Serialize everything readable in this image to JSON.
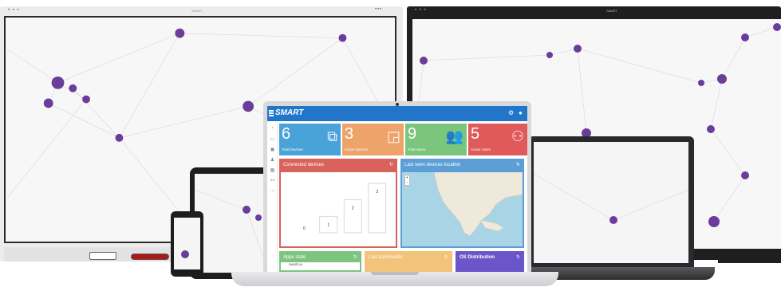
{
  "brand": {
    "logo_text": "SMART",
    "small_logo": "SMART"
  },
  "colors": {
    "accent_blue": "#2176c9",
    "tile_blue": "#4aa3d8",
    "tile_orange": "#eea36a",
    "tile_green": "#7bc57d",
    "tile_red": "#e05a5a",
    "card_red": "#d9635a",
    "card_blue": "#5b9fd6",
    "card_green": "#7dc57f",
    "card_yellow": "#f2c37a",
    "card_purple": "#6a56c8",
    "node_purple": "#6a3d9a"
  },
  "header": {
    "menu_icon": "menu-icon",
    "settings_icon": "gear-icon",
    "user_icon": "user-icon"
  },
  "sidebar": {
    "items": [
      {
        "icon": "home-icon"
      },
      {
        "icon": "display-icon"
      },
      {
        "icon": "monitor-icon"
      },
      {
        "icon": "users-icon"
      },
      {
        "icon": "apps-icon"
      },
      {
        "icon": "link-icon"
      },
      {
        "icon": "more-icon"
      }
    ]
  },
  "stats": [
    {
      "value": "6",
      "label": "Total Devices",
      "icon": "devices-icon"
    },
    {
      "value": "3",
      "label": "Active Devices",
      "icon": "cast-icon"
    },
    {
      "value": "9",
      "label": "Total Users",
      "icon": "users-icon"
    },
    {
      "value": "5",
      "label": "Active Users",
      "icon": "people-outline-icon"
    }
  ],
  "cards": {
    "connected": {
      "title": "Connected devices"
    },
    "location": {
      "title": "Last seen devices location"
    },
    "apps": {
      "title": "Apps state",
      "item": "SMARTUA"
    },
    "commands": {
      "title": "Last commands"
    },
    "os": {
      "title": "OS Distribution"
    }
  },
  "chart_data": {
    "type": "bar",
    "categories": [
      "",
      "",
      "",
      ""
    ],
    "values": [
      0,
      1,
      2,
      3
    ],
    "value_labels": [
      "0",
      "1",
      "2",
      "3"
    ],
    "title": "Connected devices",
    "ylim": [
      0,
      3
    ]
  },
  "map": {
    "zoom_in": "+",
    "zoom_out": "-"
  }
}
